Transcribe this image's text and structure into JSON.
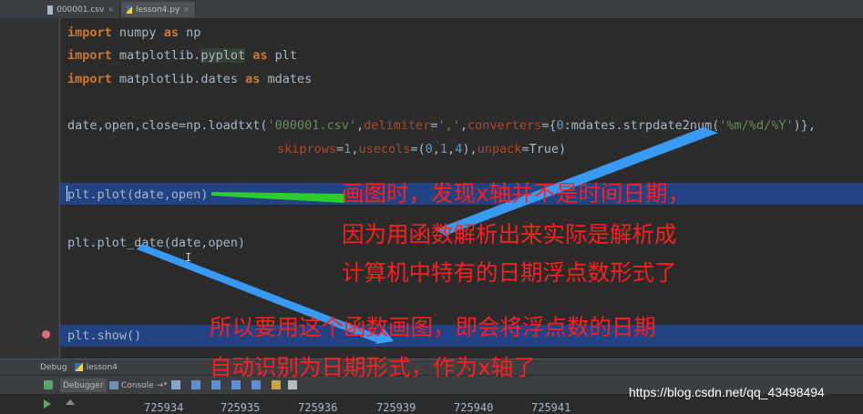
{
  "tabs": [
    {
      "label": "000001.csv",
      "close": "×"
    },
    {
      "label": "lesson4.py",
      "close": "×"
    }
  ],
  "code": {
    "line1": {
      "kw": "import",
      "rest": " numpy ",
      "kw2": "as",
      "rest2": " np"
    },
    "line2": {
      "kw": "import",
      "rest": " matplotlib.",
      "attr": "pyplot",
      "sp": " ",
      "kw2": "as",
      "rest2": " plt"
    },
    "line3": {
      "kw": "import",
      "rest": " matplotlib.dates ",
      "kw2": "as",
      "rest2": " mdates"
    },
    "line4": {
      "a": "date,open,close=np.loadtxt(",
      "s1": "'000001.csv'",
      "b": ",",
      "k1": "delimiter",
      "c": "=",
      "s2": "','",
      "d": ",",
      "k2": "converters",
      "e": "={",
      "n1": "0",
      "f": ":mdates.strpdate2num(",
      "s3": "'%m/%d/%Y'",
      "g": ")},"
    },
    "line5": {
      "k1": "skiprows",
      "a": "=",
      "n1": "1",
      "b": ",",
      "k2": "usecols",
      "c": "=(",
      "n2": "0",
      "d": ",",
      "n3": "1",
      "e": ",",
      "n4": "4",
      "f": "),",
      "k3": "unpack",
      "g": "=True)"
    },
    "line6": "plt.plot(date,open)",
    "line7": "plt.plot_date(date,open)",
    "line8": "plt.show()"
  },
  "annotations": {
    "block1_line1": "画图时，发现x轴并不是时间日期，",
    "block1_line2": "因为用函数解析出来实际是解析成",
    "block1_line3": "计算机中特有的日期浮点数形式了",
    "block2_line1": "所以要用这个函数画图，即会将浮点数的日期",
    "block2_line2": "自动识别为日期形式，作为x轴了"
  },
  "debug": {
    "panel_label": "Debug",
    "config_name": "lesson4",
    "debugger_tab": "Debugger",
    "console_tab": "Console →*",
    "output_numbers": [
      "725934",
      "725935",
      "725936",
      "725939",
      "725940",
      "725941"
    ]
  },
  "watermark": "https://blog.csdn.net/qq_43498494",
  "colors": {
    "annotation": "#ff1e1e",
    "arrow_blue": "#3aa0ff",
    "arrow_green": "#2ecc2e",
    "highlight": "#214283"
  }
}
